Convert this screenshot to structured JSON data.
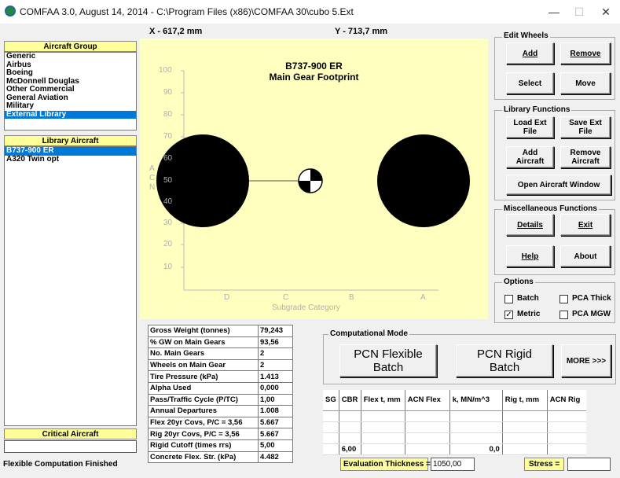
{
  "window": {
    "title": "COMFAA 3.0, August 14, 2014 - C:\\Program Files (x86)\\COMFAA 30\\cubo 5.Ext",
    "minimize": "—",
    "maximize": "☐",
    "close": "✕"
  },
  "left": {
    "aircraft_group_header": "Aircraft Group",
    "groups": [
      "Generic",
      "Airbus",
      "Boeing",
      "McDonnell Douglas",
      "Other Commercial",
      "General Aviation",
      "Military",
      "External Library"
    ],
    "library_header": "Library Aircraft",
    "library": [
      "B737-900 ER",
      "A320 Twin opt"
    ],
    "critical_header": "Critical Aircraft",
    "critical_value": "",
    "status": "Flexible Computation Finished"
  },
  "plot": {
    "x_readout": "X - 617,2 mm",
    "y_readout": "Y - 713,7 mm",
    "title": "B737-900 ER",
    "subtitle": "Main Gear Footprint",
    "y_axis_label": [
      "A",
      "C",
      "N"
    ],
    "y_ticks": [
      "100",
      "90",
      "80",
      "70",
      "60",
      "50",
      "40",
      "30",
      "20",
      "10"
    ],
    "x_ticks": [
      "D",
      "C",
      "B",
      "A"
    ],
    "x_axis_label": "Subgrade Category"
  },
  "edit_wheels": {
    "label": "Edit Wheels",
    "add": "Add",
    "remove": "Remove",
    "select": "Select",
    "move": "Move"
  },
  "library_functions": {
    "label": "Library Functions",
    "load_ext_file_1": "Load Ext",
    "load_ext_file_2": "File",
    "save_ext_file_1": "Save Ext",
    "save_ext_file_2": "File",
    "add_aircraft_1": "Add",
    "add_aircraft_2": "Aircraft",
    "remove_aircraft_1": "Remove",
    "remove_aircraft_2": "Aircraft",
    "open_aircraft_window": "Open Aircraft Window"
  },
  "misc_functions": {
    "label": "Miscellaneous Functions",
    "details": "Details",
    "exit": "Exit",
    "help": "Help",
    "about": "About"
  },
  "options": {
    "label": "Options",
    "batch": "Batch",
    "pca_thick": "PCA Thick",
    "metric": "Metric",
    "pca_mgw": "PCA MGW",
    "batch_checked": false,
    "pca_thick_checked": false,
    "metric_checked": true,
    "pca_mgw_checked": false
  },
  "params": [
    [
      "Gross Weight (tonnes)",
      "79,243"
    ],
    [
      "% GW on Main Gears",
      "93,56"
    ],
    [
      "No. Main Gears",
      "2"
    ],
    [
      "Wheels on Main Gear",
      "2"
    ],
    [
      "Tire Pressure (kPa)",
      "1.413"
    ],
    [
      "Alpha Used",
      "0,000"
    ],
    [
      "Pass/Traffic Cycle (P/TC)",
      "1,00"
    ],
    [
      "Annual Departures",
      "1.008"
    ],
    [
      "Flex 20yr Covs, P/C = 3,56",
      "5.667"
    ],
    [
      "Rig 20yr Covs, P/C = 3,56",
      "5.667"
    ],
    [
      "Rigid Cutoff (times rrs)",
      "5,00"
    ],
    [
      "Concrete Flex. Str. (kPa)",
      "4.482"
    ]
  ],
  "computational_mode": {
    "label": "Computational Mode",
    "pcn_flexible_1": "PCN Flexible",
    "pcn_flexible_2": "Batch",
    "pcn_rigid_1": "PCN Rigid",
    "pcn_rigid_2": "Batch",
    "more": "MORE >>>"
  },
  "results": {
    "headers": [
      "SG",
      "CBR",
      "Flex t, mm",
      "ACN Flex",
      "k, MN/m^3",
      "Rig t, mm",
      "ACN Rig"
    ],
    "rows": [
      [
        "",
        "",
        "",
        "",
        "",
        "",
        ""
      ],
      [
        "",
        "",
        "",
        "",
        "",
        "",
        ""
      ],
      [
        "",
        "",
        "",
        "",
        "",
        "",
        ""
      ],
      [
        "",
        "6,00",
        "",
        "",
        "0,0",
        "",
        ""
      ]
    ]
  },
  "bottom": {
    "eval_thickness_label": "Evaluation Thickness =",
    "eval_thickness_value": "1050,00",
    "stress_label": "Stress =",
    "stress_value": ""
  },
  "colors": {
    "plot_bg": "#ffffc0",
    "header_yellow": "#ffff99",
    "selection_blue": "#0078d7"
  }
}
